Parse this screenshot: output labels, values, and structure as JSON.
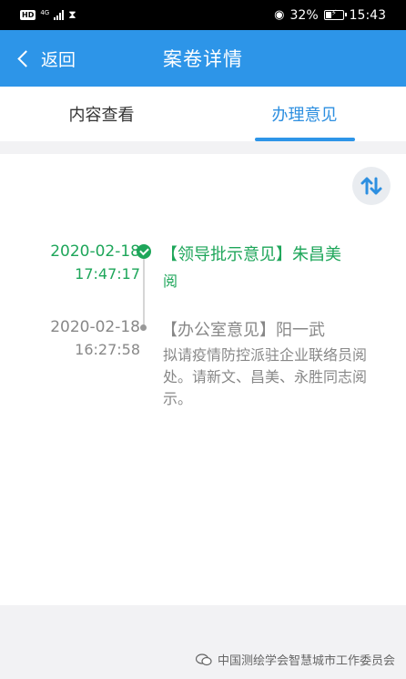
{
  "status_bar": {
    "hd": "HD",
    "network": "4G",
    "battery_percent": "32%",
    "time": "15:43"
  },
  "header": {
    "back_label": "返回",
    "title": "案卷详情"
  },
  "tabs": [
    {
      "label": "内容查看",
      "active": false
    },
    {
      "label": "办理意见",
      "active": true
    }
  ],
  "timeline": [
    {
      "date": "2020-02-18",
      "time": "17:47:17",
      "title": "【领导批示意见】朱昌美",
      "body": "阅",
      "status": "done"
    },
    {
      "date": "2020-02-18",
      "time": "16:27:58",
      "title": "【办公室意见】阳一武",
      "body": "拟请疫情防控派驻企业联络员阅处。请新文、昌美、永胜同志阅示。",
      "status": "normal"
    }
  ],
  "watermark": "中国测绘学会智慧城市工作委员会",
  "colors": {
    "accent": "#2d95e8",
    "done": "#1ea65a",
    "muted": "#888888"
  }
}
